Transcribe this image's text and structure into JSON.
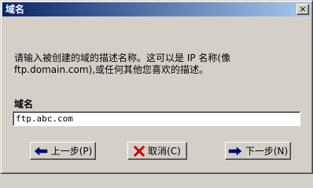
{
  "window": {
    "title": "域名",
    "close_glyph": "×"
  },
  "description": {
    "line1": "请输入被创建的域的描述名称。这可以是 IP 名称(像",
    "line2": "ftp.domain.com),或任何其他您喜欢的描述。"
  },
  "field": {
    "label": "域名",
    "value": "ftp.abc.com"
  },
  "buttons": {
    "back_label": "上一步(P)",
    "back_icon": "arrow-left-icon",
    "cancel_label": "取消(C)",
    "cancel_icon": "x-icon",
    "next_label": "下一步(N)",
    "next_icon": "arrow-right-icon"
  },
  "colors": {
    "titlebar_start": "#0a246a",
    "titlebar_end": "#a6caf0",
    "face": "#d4d0c8",
    "cancel_x": "#cc0000",
    "arrow": "#000080"
  }
}
